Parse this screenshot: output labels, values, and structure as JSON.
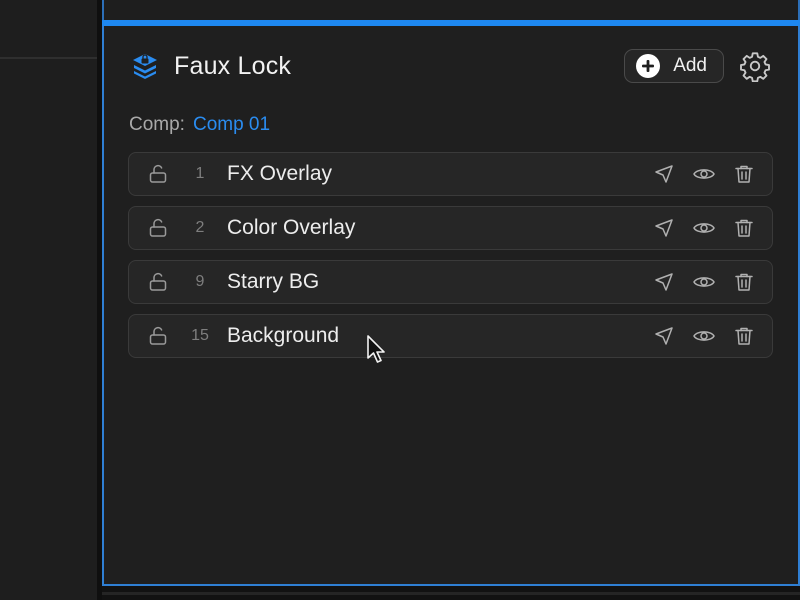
{
  "panel": {
    "title": "Faux Lock",
    "add_label": "Add",
    "logo_icon": "layers-icon",
    "settings_icon": "gear-icon",
    "accent_color": "#1e88f0"
  },
  "comp": {
    "label": "Comp:",
    "value": "Comp 01"
  },
  "layers": [
    {
      "index": "1",
      "name": "FX Overlay"
    },
    {
      "index": "2",
      "name": "Color Overlay"
    },
    {
      "index": "9",
      "name": "Starry BG"
    },
    {
      "index": "15",
      "name": "Background"
    }
  ],
  "row_icons": [
    "unlock-icon",
    "select-arrow-icon",
    "eye-icon",
    "trash-icon"
  ]
}
